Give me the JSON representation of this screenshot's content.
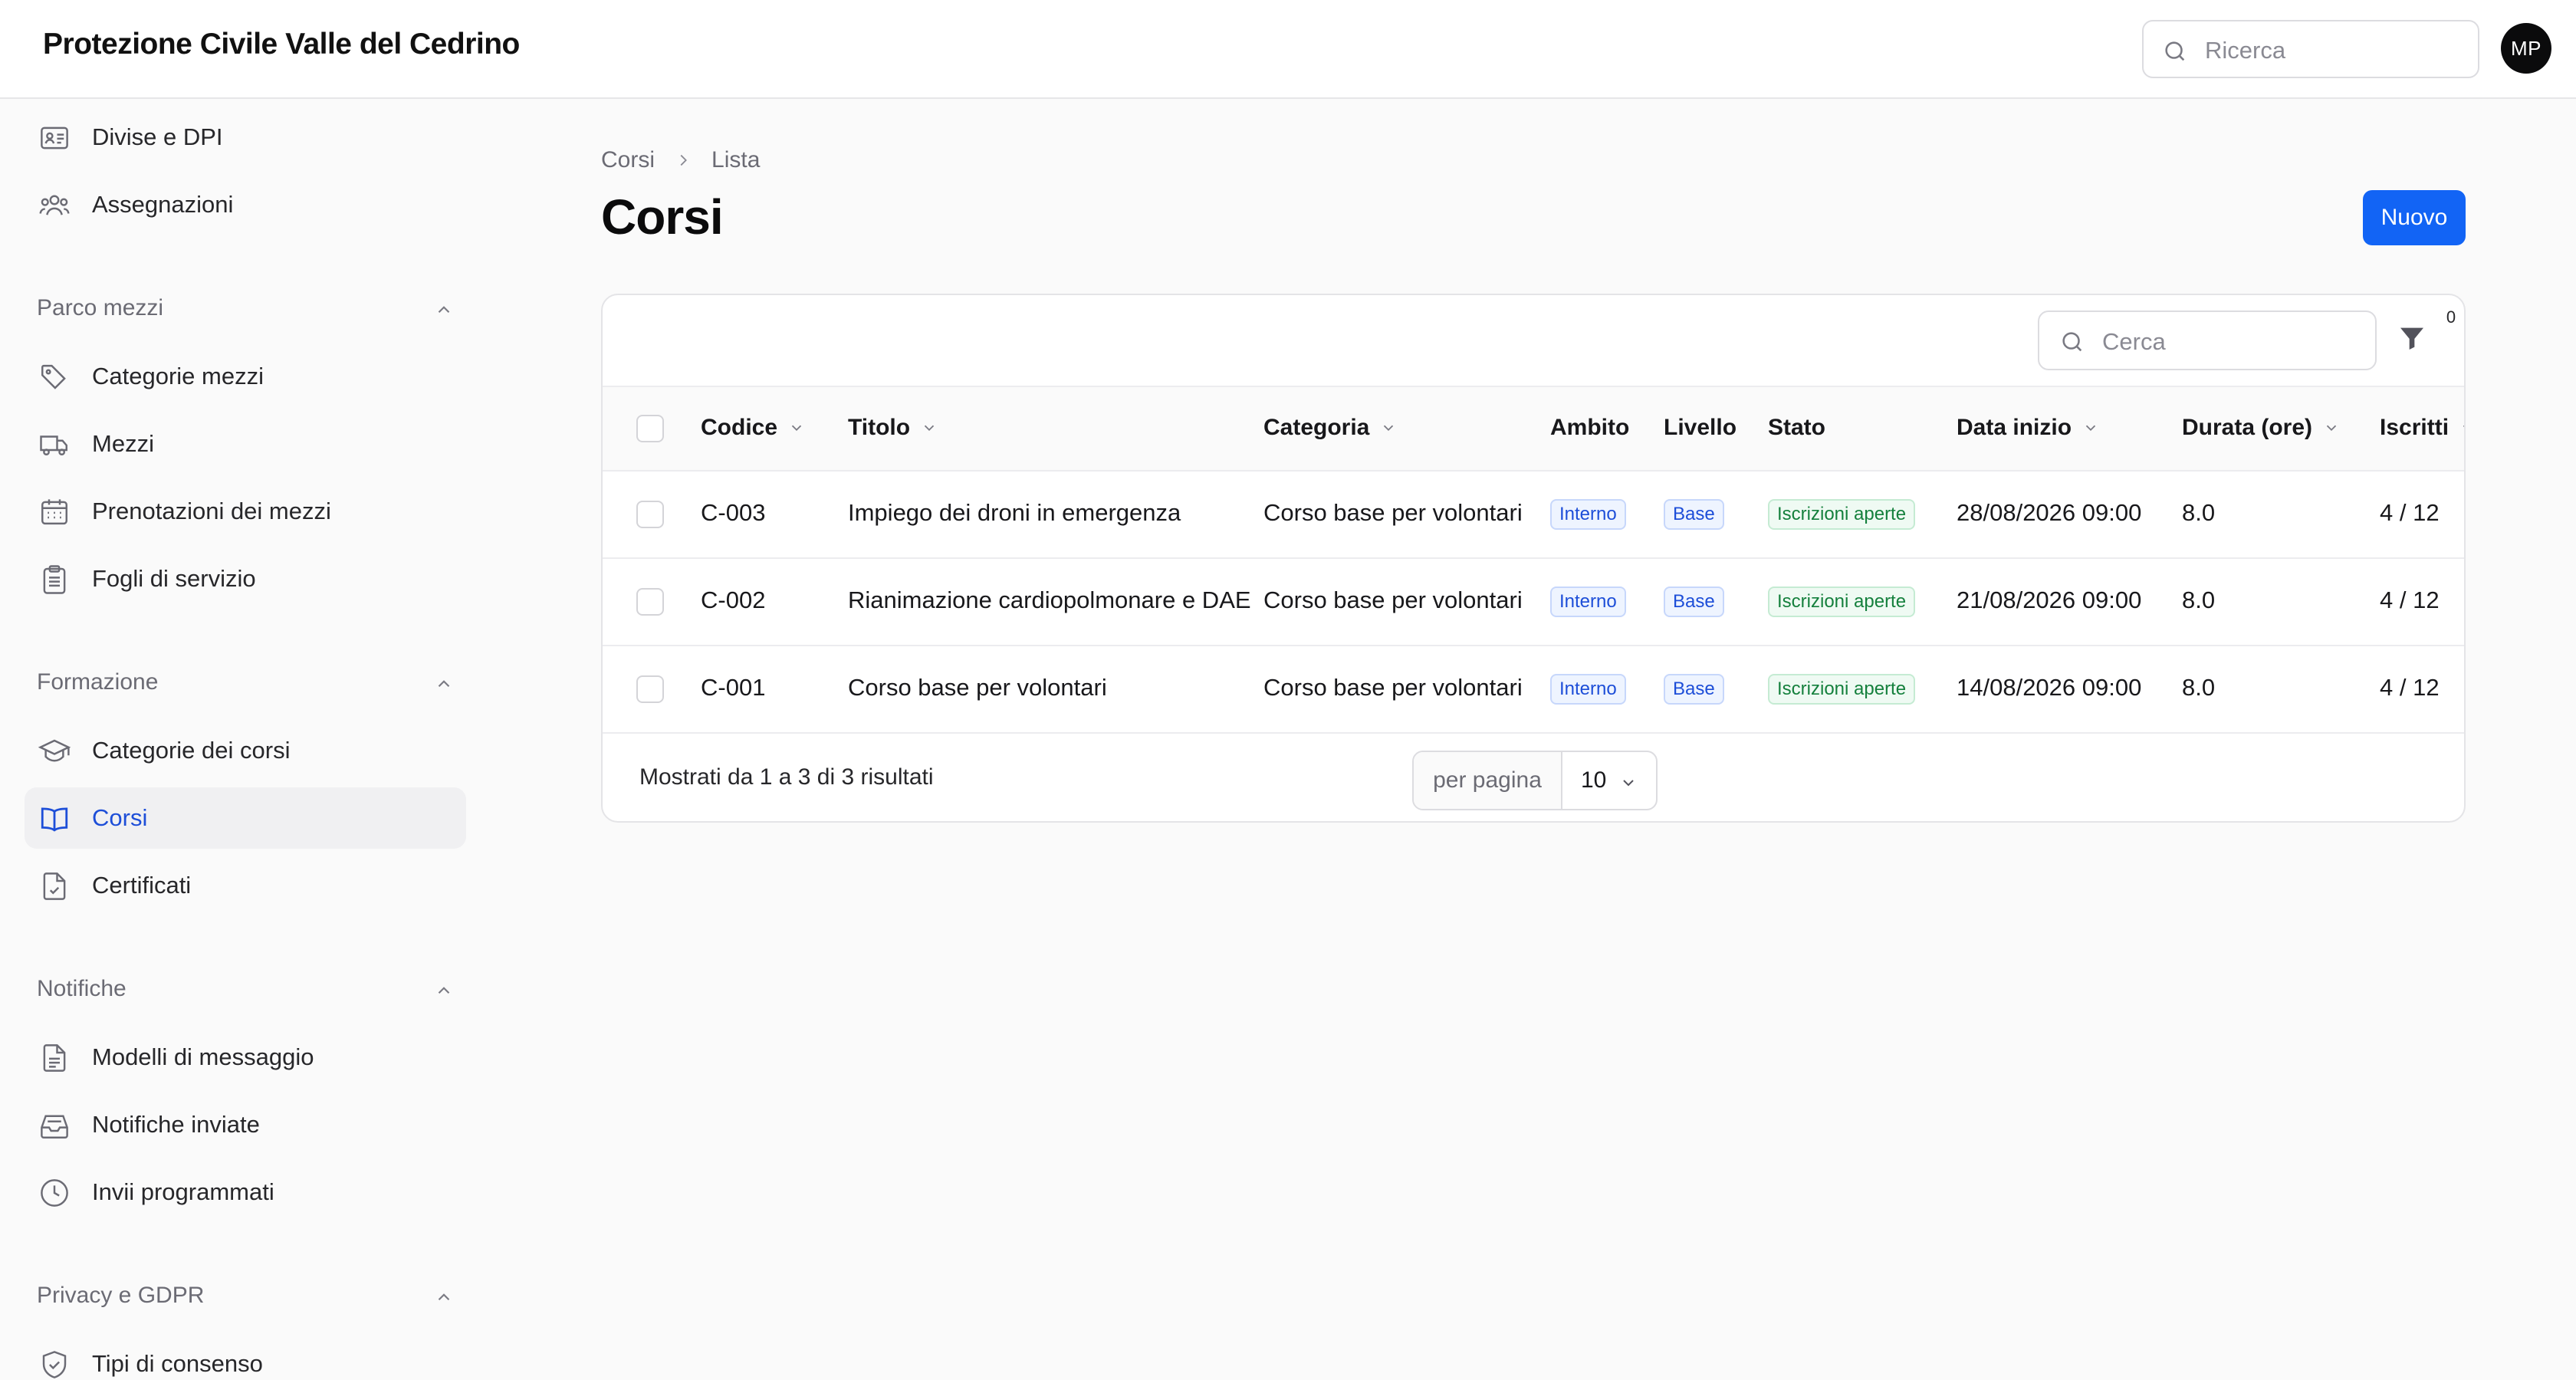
{
  "header": {
    "brand": "Protezione Civile Valle del Cedrino",
    "search_placeholder": "Ricerca",
    "avatar_initials": "MP"
  },
  "sidebar": {
    "top_items": [
      {
        "label": "Divise e DPI",
        "icon": "id-card-icon"
      },
      {
        "label": "Assegnazioni",
        "icon": "users-icon"
      }
    ],
    "groups": [
      {
        "label": "Parco mezzi",
        "items": [
          {
            "label": "Categorie mezzi",
            "icon": "tag-icon"
          },
          {
            "label": "Mezzi",
            "icon": "truck-icon"
          },
          {
            "label": "Prenotazioni dei mezzi",
            "icon": "calendar-icon"
          },
          {
            "label": "Fogli di servizio",
            "icon": "clipboard-icon"
          }
        ]
      },
      {
        "label": "Formazione",
        "items": [
          {
            "label": "Categorie dei corsi",
            "icon": "graduation-cap-icon"
          },
          {
            "label": "Corsi",
            "icon": "book-open-icon",
            "active": true
          },
          {
            "label": "Certificati",
            "icon": "document-check-icon"
          }
        ]
      },
      {
        "label": "Notifiche",
        "items": [
          {
            "label": "Modelli di messaggio",
            "icon": "document-text-icon"
          },
          {
            "label": "Notifiche inviate",
            "icon": "inbox-icon"
          },
          {
            "label": "Invii programmati",
            "icon": "clock-icon"
          }
        ]
      },
      {
        "label": "Privacy e GDPR",
        "items": [
          {
            "label": "Tipi di consenso",
            "icon": "shield-check-icon"
          }
        ]
      }
    ]
  },
  "breadcrumb": {
    "parent": "Corsi",
    "current": "Lista"
  },
  "page": {
    "title": "Corsi",
    "new_button": "Nuovo"
  },
  "table": {
    "search_placeholder": "Cerca",
    "filter_count": "0",
    "columns": [
      "Codice",
      "Titolo",
      "Categoria",
      "Ambito",
      "Livello",
      "Stato",
      "Data inizio",
      "Durata (ore)",
      "Iscritti"
    ],
    "rows": [
      {
        "codice": "C-003",
        "titolo": "Impiego dei droni in emergenza",
        "categoria": "Corso base per volontari",
        "ambito": "Interno",
        "livello": "Base",
        "stato": "Iscrizioni aperte",
        "data_inizio": "28/08/2026 09:00",
        "durata": "8.0",
        "iscritti": "4 / 12"
      },
      {
        "codice": "C-002",
        "titolo": "Rianimazione cardiopolmonare e DAE",
        "categoria": "Corso base per volontari",
        "ambito": "Interno",
        "livello": "Base",
        "stato": "Iscrizioni aperte",
        "data_inizio": "21/08/2026 09:00",
        "durata": "8.0",
        "iscritti": "4 / 12"
      },
      {
        "codice": "C-001",
        "titolo": "Corso base per volontari",
        "categoria": "Corso base per volontari",
        "ambito": "Interno",
        "livello": "Base",
        "stato": "Iscrizioni aperte",
        "data_inizio": "14/08/2026 09:00",
        "durata": "8.0",
        "iscritti": "4 / 12"
      }
    ],
    "summary": "Mostrati da 1 a 3 di 3 risultati",
    "per_page_label": "per pagina",
    "per_page_value": "10"
  },
  "colors": {
    "accent": "#1264f5",
    "active_nav": "#1d4ed8",
    "badge_green": "#15803d"
  }
}
